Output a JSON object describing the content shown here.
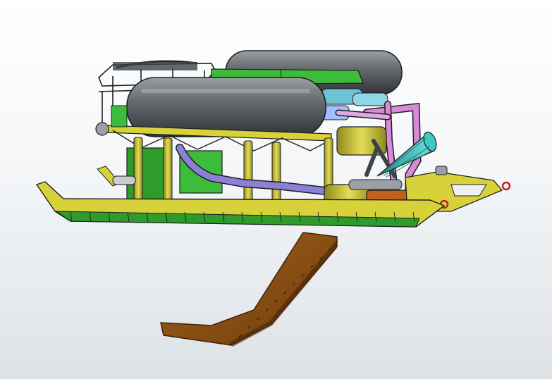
{
  "scene": {
    "kind": "cad-3d-model-view",
    "background_top": "#ffffff",
    "background_bottom": "#dde2e7"
  },
  "colors": {
    "tank_dark": "#3f4346",
    "tank_mid": "#6c7176",
    "tank_light": "#9aa0a5",
    "frame_yellow": "#d8d23a",
    "frame_yellow_dark": "#9c9722",
    "skid_green": "#2e9b2b",
    "panel_green": "#3dbb3a",
    "pipe_purple": "#8b7fd6",
    "pipe_pink": "#d88ad8",
    "pipe_cyan": "#6cc3d8",
    "cone_teal": "#3fc7c4",
    "bracket_orange": "#c0621e",
    "arm_brown": "#8a4f14",
    "arm_brown_dark": "#4e2a08",
    "outline": "#1d1f20"
  },
  "icons": {
    "tank-left": "pressure-tank",
    "tank-right": "pressure-tank",
    "nozzle": "cone-nozzle",
    "skid": "sled-skid",
    "arm": "tow-arm"
  }
}
